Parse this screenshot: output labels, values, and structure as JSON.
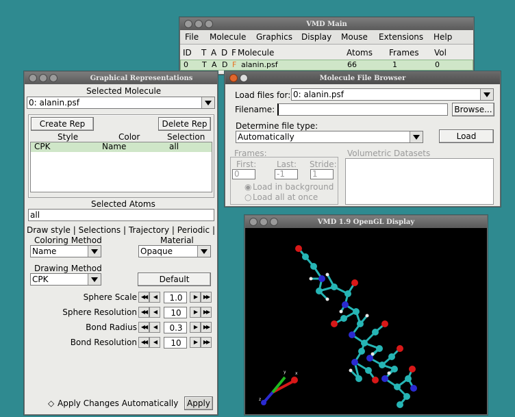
{
  "vmd_main": {
    "title": "VMD Main",
    "menu": [
      "File",
      "Molecule",
      "Graphics",
      "Display",
      "Mouse",
      "Extensions",
      "Help"
    ],
    "columns": {
      "id": "ID",
      "t": "T",
      "a": "A",
      "d": "D",
      "f": "F",
      "molecule": "Molecule",
      "atoms": "Atoms",
      "frames": "Frames",
      "vol": "Vol"
    },
    "row": {
      "id": "0",
      "t": "T",
      "a": "A",
      "d": "D",
      "f": "F",
      "molecule": "alanin.psf",
      "atoms": "66",
      "frames": "1",
      "vol": "0"
    }
  },
  "graphical_reps": {
    "title": "Graphical Representations",
    "selected_molecule_label": "Selected Molecule",
    "selected_molecule": "0: alanin.psf",
    "create_rep": "Create Rep",
    "delete_rep": "Delete Rep",
    "headers": {
      "style": "Style",
      "color": "Color",
      "selection": "Selection"
    },
    "rep_row": {
      "style": "CPK",
      "color": "Name",
      "selection": "all"
    },
    "selected_atoms_label": "Selected Atoms",
    "selected_atoms": "all",
    "tabs": [
      "Draw style",
      "Selections",
      "Trajectory",
      "Periodic"
    ],
    "coloring_method_label": "Coloring Method",
    "coloring_method": "Name",
    "material_label": "Material",
    "material": "Opaque",
    "drawing_method_label": "Drawing Method",
    "drawing_method": "CPK",
    "default_button": "Default",
    "params": [
      {
        "label": "Sphere Scale",
        "value": "1.0"
      },
      {
        "label": "Sphere Resolution",
        "value": "10"
      },
      {
        "label": "Bond Radius",
        "value": "0.3"
      },
      {
        "label": "Bond Resolution",
        "value": "10"
      }
    ],
    "apply_auto": "Apply Changes Automatically",
    "apply_button": "Apply"
  },
  "file_browser": {
    "title": "Molecule File Browser",
    "load_for_label": "Load files for:",
    "load_for": "0: alanin.psf",
    "filename_label": "Filename:",
    "filename": "",
    "browse": "Browse...",
    "file_type_label": "Determine file type:",
    "file_type": "Automatically",
    "load": "Load",
    "frames_label": "Frames:",
    "first_label": "First:",
    "last_label": "Last:",
    "stride_label": "Stride:",
    "first": "0",
    "last": "-1",
    "stride": "1",
    "load_background": "Load in background",
    "load_all": "Load all at once",
    "volumetric_label": "Volumetric Datasets"
  },
  "opengl": {
    "title": "VMD 1.9 OpenGL Display"
  },
  "colors": {
    "desktop": "#2f8a90",
    "highlight_row": "#cfe6c8",
    "carbon": "#26b5b5",
    "oxygen": "#d81818",
    "nitrogen": "#2a2ad0",
    "hydrogen": "#e8e8e8"
  }
}
